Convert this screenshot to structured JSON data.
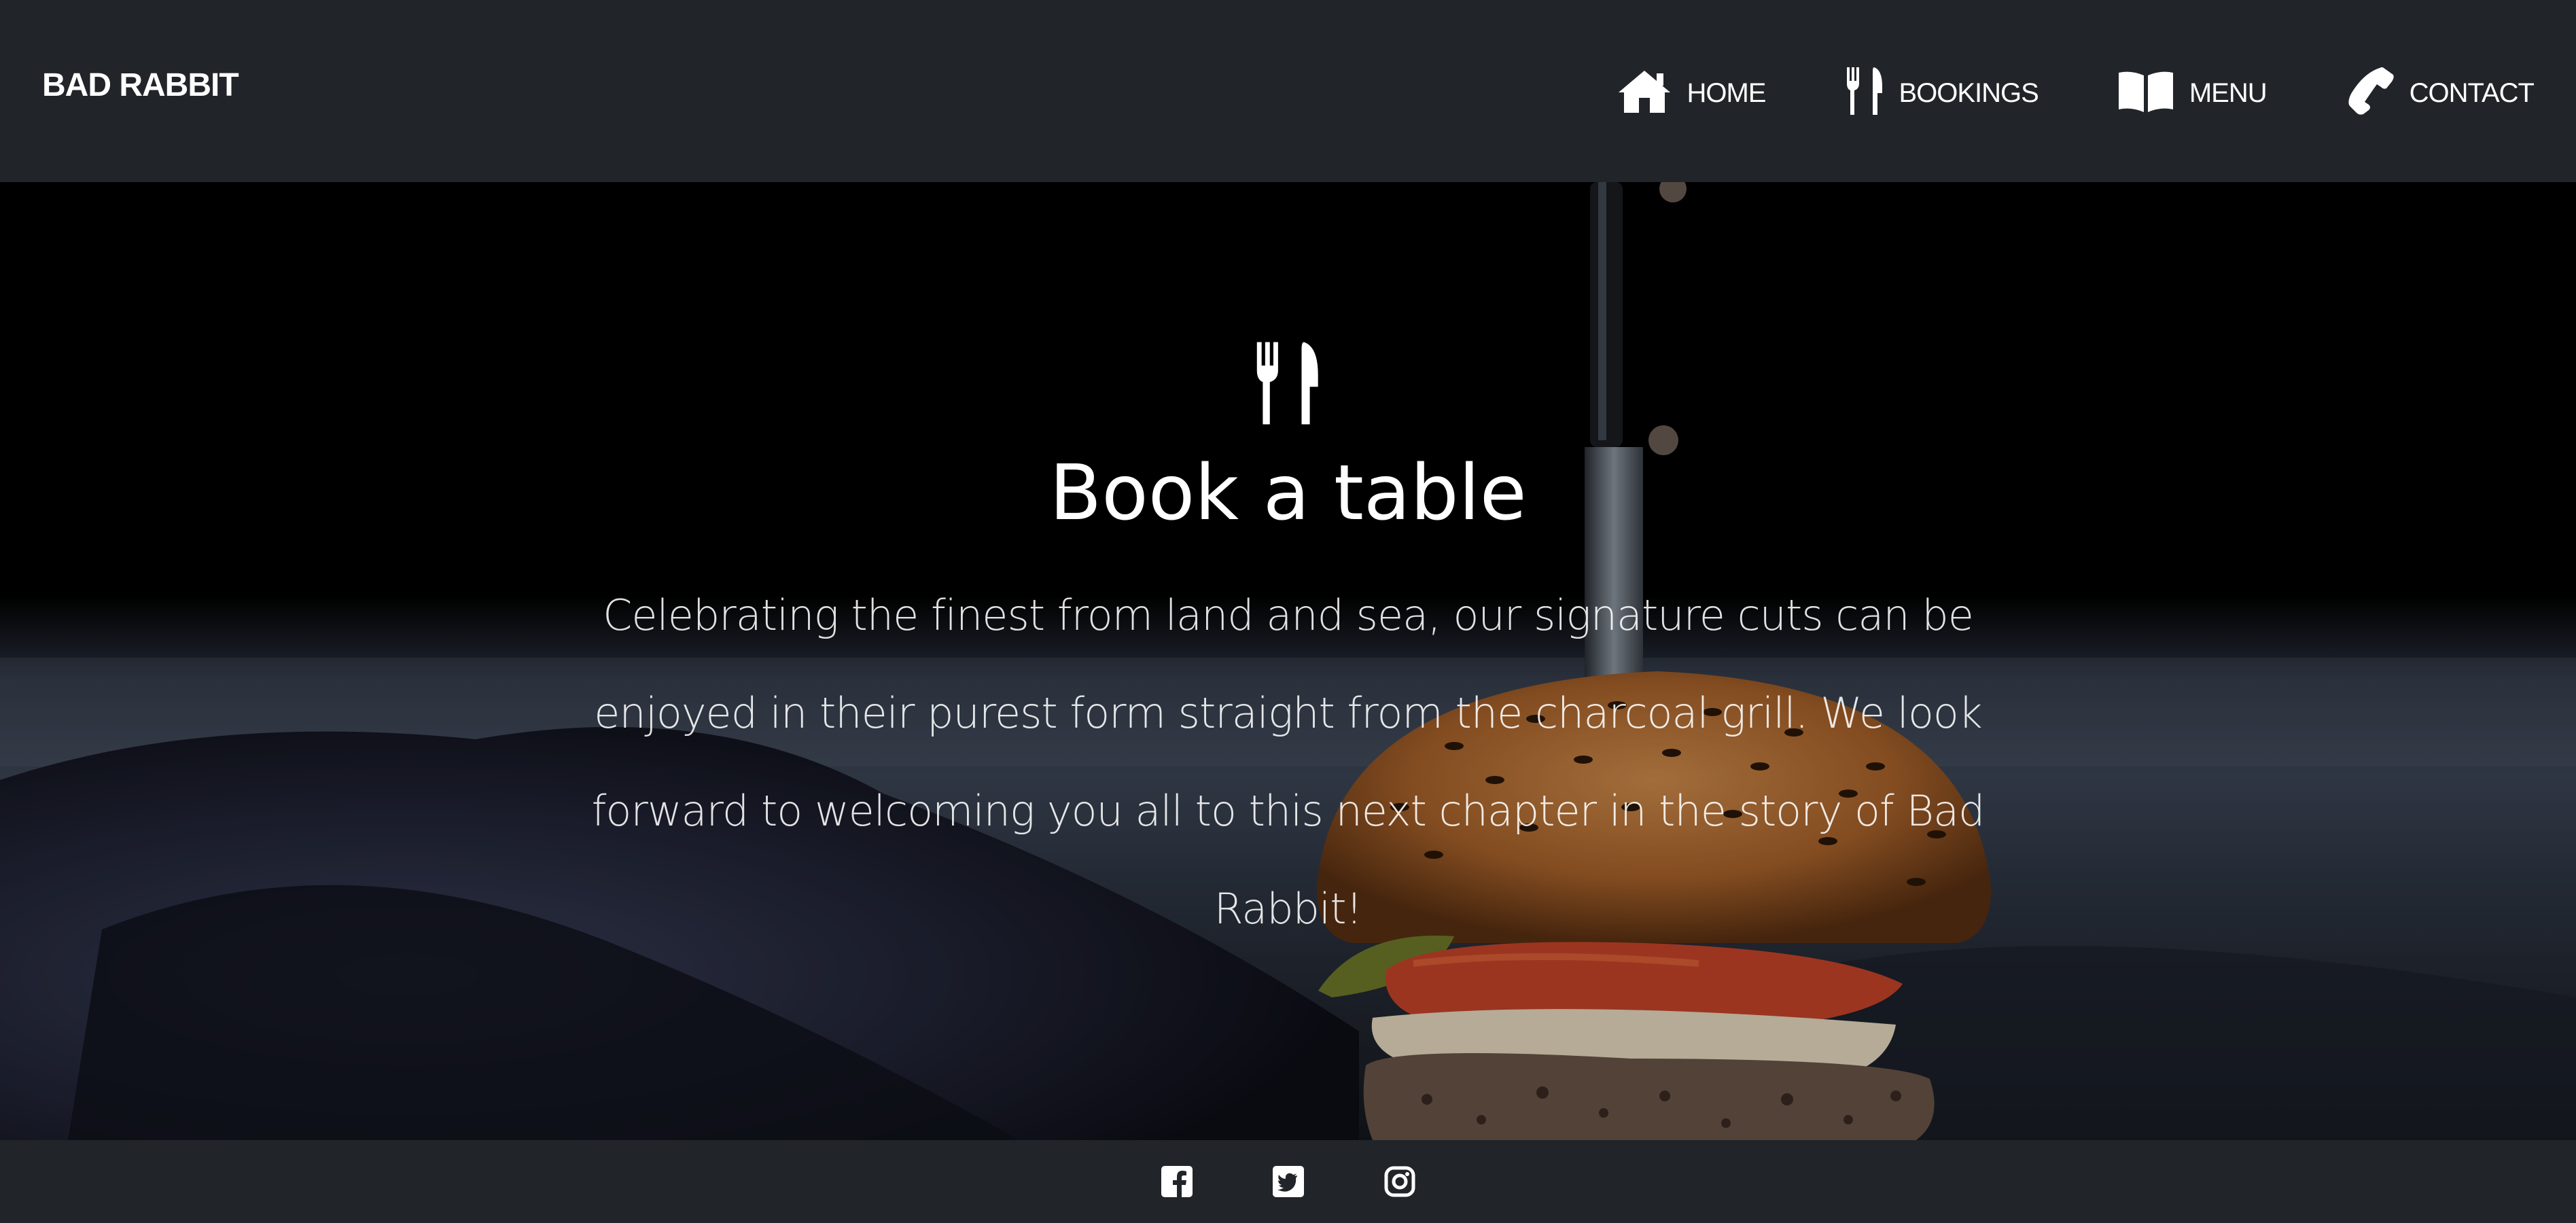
{
  "navbar": {
    "brand": "BAD RABBIT",
    "items": [
      {
        "label": "HOME",
        "icon": "home-icon"
      },
      {
        "label": "BOOKINGS",
        "icon": "utensils-icon"
      },
      {
        "label": "MENU",
        "icon": "book-open-icon"
      },
      {
        "label": "CONTACT",
        "icon": "phone-icon"
      }
    ]
  },
  "hero": {
    "icon": "utensils-icon",
    "title": "Book a table",
    "text": "Celebrating the finest from land and sea, our signature cuts can be enjoyed in their purest form straight from the charcoal grill. We look forward to welcoming you all to this next chapter in the story of Bad Rabbit!"
  },
  "footer": {
    "social": [
      "facebook-icon",
      "twitter-icon",
      "instagram-icon"
    ]
  },
  "colors": {
    "navbar_bg": "#212529",
    "text": "#ffffff"
  }
}
